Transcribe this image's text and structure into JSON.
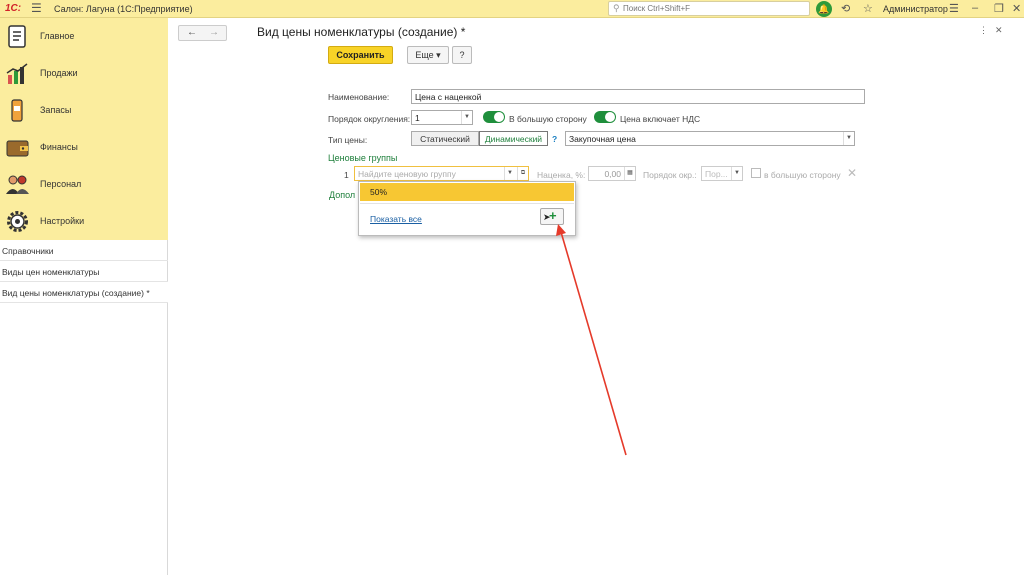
{
  "titlebar": {
    "logo": "1С:",
    "app_title": "Салон: Лагуна  (1С:Предприятие)",
    "search_placeholder": "Поиск Ctrl+Shift+F",
    "user": "Администратор"
  },
  "sidebar": {
    "nav": [
      {
        "label": "Главное",
        "icon": "home-icon"
      },
      {
        "label": "Продажи",
        "icon": "sales-chart-icon"
      },
      {
        "label": "Запасы",
        "icon": "stock-icon"
      },
      {
        "label": "Финансы",
        "icon": "wallet-icon"
      },
      {
        "label": "Персонал",
        "icon": "people-icon"
      },
      {
        "label": "Настройки",
        "icon": "gear-icon"
      }
    ],
    "open_windows": [
      "Справочники",
      "Виды цен номенклатуры",
      "Вид цены номенклатуры (создание) *"
    ]
  },
  "form": {
    "title": "Вид цены номенклатуры (создание) *",
    "save_label": "Сохранить",
    "more_label": "Еще",
    "help_label": "?",
    "name_label": "Наименование:",
    "name_value": "Цена с наценкой",
    "rounding_label": "Порядок округления:",
    "rounding_value": "1",
    "round_up_label": "В большую сторону",
    "vat_label": "Цена включает НДС",
    "price_type_label": "Тип цены:",
    "static_label": "Статический",
    "dynamic_label": "Динамический",
    "help_q": "?",
    "base_price_value": "Закупочная цена",
    "price_groups_title": "Ценовые группы",
    "row_number": "1",
    "group_placeholder": "Найдите ценовую группу",
    "markup_label": "Наценка, %:",
    "markup_value": "0,00",
    "round_order_label": "Порядок окр.:",
    "round_order_placeholder": "Пор...",
    "round_up_row_label": "в большую сторону",
    "extra_section": "Допол"
  },
  "popup": {
    "item": "50%",
    "show_all": "Показать все"
  },
  "colors": {
    "accent_yellow": "#fbed9e",
    "save_button": "#f8d327",
    "toggle_green": "#1f8f3c",
    "annotation_arrow": "#e53a2a"
  }
}
